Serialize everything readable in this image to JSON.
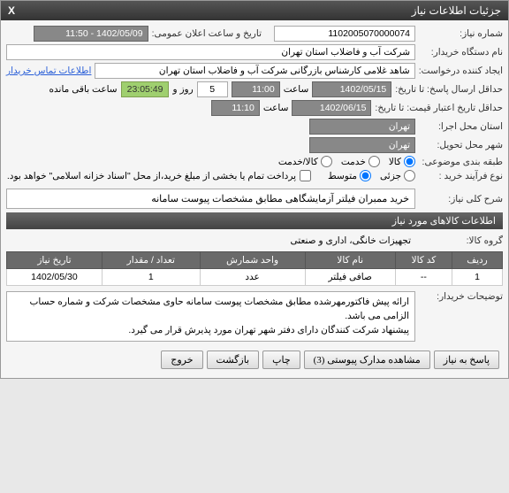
{
  "window": {
    "title": "جزئیات اطلاعات نیاز",
    "close": "X"
  },
  "fields": {
    "need_no_label": "شماره نیاز:",
    "need_no": "1102005070000074",
    "public_date_label": "تاریخ و ساعت اعلان عمومی:",
    "public_date": "1402/05/09 - 11:50",
    "buyer_org_label": "نام دستگاه خریدار:",
    "buyer_org": "شرکت آب و فاضلاب استان تهران",
    "requester_label": "ایجاد کننده درخواست:",
    "requester": "شاهد غلامی کارشناس بازرگانی شرکت آب و فاضلاب استان تهران",
    "contact_link": "اطلاعات تماس خریدار",
    "deadline_label": "حداقل ارسال پاسخ: تا تاریخ:",
    "deadline_date": "1402/05/15",
    "time_label": "ساعت",
    "deadline_time": "11:00",
    "days_remain": "5",
    "days_and": "روز و",
    "countdown": "23:05:49",
    "remain_text": "ساعت باقی مانده",
    "validity_label": "حداقل تاریخ اعتبار قیمت: تا تاریخ:",
    "validity_date": "1402/06/15",
    "validity_time": "11:10",
    "exec_city_label": "استان محل اجرا:",
    "exec_city": "تهران",
    "delivery_city_label": "شهر محل تحویل:",
    "delivery_city": "تهران",
    "category_label": "طبقه بندی موضوعی:",
    "cat_goods": "کالا",
    "cat_service": "خدمت",
    "cat_goods_service": "کالا/خدمت",
    "purchase_type_label": "نوع فرآیند خرید :",
    "pt_small": "جزئی",
    "pt_medium": "متوسط",
    "pt_note": "پرداخت تمام یا بخشی از مبلغ خرید،از محل \"اسناد خزانه اسلامی\" خواهد بود.",
    "general_desc_label": "شرح کلی نیاز:",
    "general_desc": "خرید ممبران فیلتر آزمایشگاهی مطابق مشخصات پیوست سامانه"
  },
  "goods_section": {
    "title": "اطلاعات کالاهای مورد نیاز",
    "group_label": "گروه کالا:",
    "group_value": "تجهیزات خانگی، اداری و صنعتی"
  },
  "table": {
    "headers": {
      "row": "ردیف",
      "code": "کد کالا",
      "name": "نام کالا",
      "unit": "واحد شمارش",
      "qty": "تعداد / مقدار",
      "date": "تاریخ نیاز"
    },
    "rows": [
      {
        "row": "1",
        "code": "--",
        "name": "صافی فیلتر",
        "unit": "عدد",
        "qty": "1",
        "date": "1402/05/30"
      }
    ]
  },
  "buyer_notes": {
    "label": "توضیحات خریدار:",
    "text": "ارائه پیش فاکتورمهرشده مطابق مشخصات پیوست سامانه حاوی مشخصات شرکت و شماره حساب الزامی می باشد.\nپیشنهاد شرکت کنندگان دارای دفتر شهر تهران مورد پذیرش قرار می گیرد."
  },
  "buttons": {
    "respond": "پاسخ به نیاز",
    "attachments": "مشاهده مدارک پیوستی (3)",
    "print": "چاپ",
    "back": "بازگشت",
    "exit": "خروج"
  }
}
